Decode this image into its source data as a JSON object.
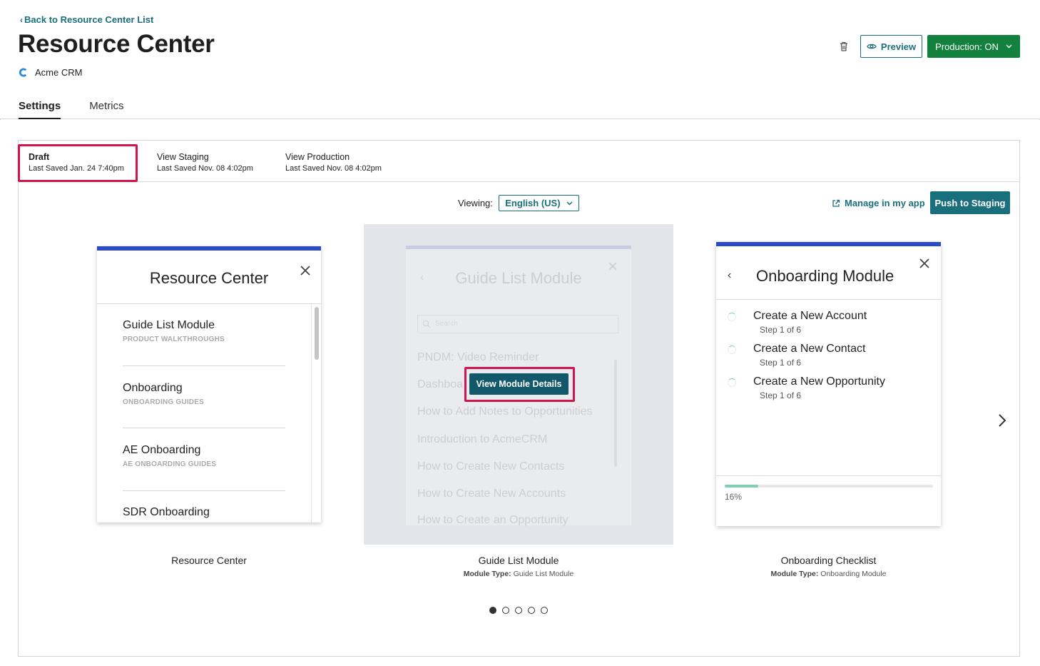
{
  "header": {
    "back_link": "Back to Resource Center List",
    "title": "Resource Center",
    "app_name": "Acme CRM",
    "preview_label": "Preview",
    "production_label": "Production: ON"
  },
  "tabs": [
    {
      "label": "Settings",
      "active": true
    },
    {
      "label": "Metrics",
      "active": false
    }
  ],
  "versions": [
    {
      "name": "Draft",
      "saved": "Last Saved Jan. 24 7:40pm"
    },
    {
      "name": "View Staging",
      "saved": "Last Saved Nov. 08 4:02pm"
    },
    {
      "name": "View Production",
      "saved": "Last Saved Nov. 08 4:02pm"
    }
  ],
  "toolbar": {
    "viewing_label": "Viewing:",
    "language": "English (US)",
    "manage_label": "Manage in my app",
    "push_label": "Push to Staging"
  },
  "resource_center_card": {
    "title": "Resource Center",
    "items": [
      {
        "title": "Guide List Module",
        "subtitle": "PRODUCT WALKTHROUGHS"
      },
      {
        "title": "Onboarding",
        "subtitle": "ONBOARDING GUIDES"
      },
      {
        "title": "AE Onboarding",
        "subtitle": "AE ONBOARDING GUIDES"
      },
      {
        "title": "SDR Onboarding",
        "subtitle": ""
      }
    ],
    "label": "Resource Center"
  },
  "guide_list_card": {
    "title": "Guide List Module",
    "search_placeholder": "Search",
    "items": [
      "PNDM: Video Reminder",
      "Dashboa",
      "How to Add Notes to Opportunities",
      "Introduction to AcmeCRM",
      "How to Create New Contacts",
      "How to Create New Accounts",
      "How to Create an Opportunity"
    ],
    "view_details_label": "View Module Details",
    "label": "Guide List Module",
    "module_type_key": "Module Type:",
    "module_type_value": "Guide List Module"
  },
  "onboarding_card": {
    "title": "Onboarding Module",
    "items": [
      {
        "title": "Create a New Account",
        "step": "Step 1 of 6"
      },
      {
        "title": "Create a New Contact",
        "step": "Step 1 of 6"
      },
      {
        "title": "Create a New Opportunity",
        "step": "Step 1 of 6"
      }
    ],
    "progress": 0.16,
    "progress_label": "16%",
    "label": "Onboarding Checklist",
    "module_type_key": "Module Type:",
    "module_type_value": "Onboarding Module"
  },
  "pagination": {
    "count": 5,
    "active": 0
  },
  "colors": {
    "accent": "#1a6f7c",
    "production": "#11813d",
    "highlight": "#d2144a",
    "card_bar": "#2b4acb",
    "progress": "#7fcfb3"
  }
}
